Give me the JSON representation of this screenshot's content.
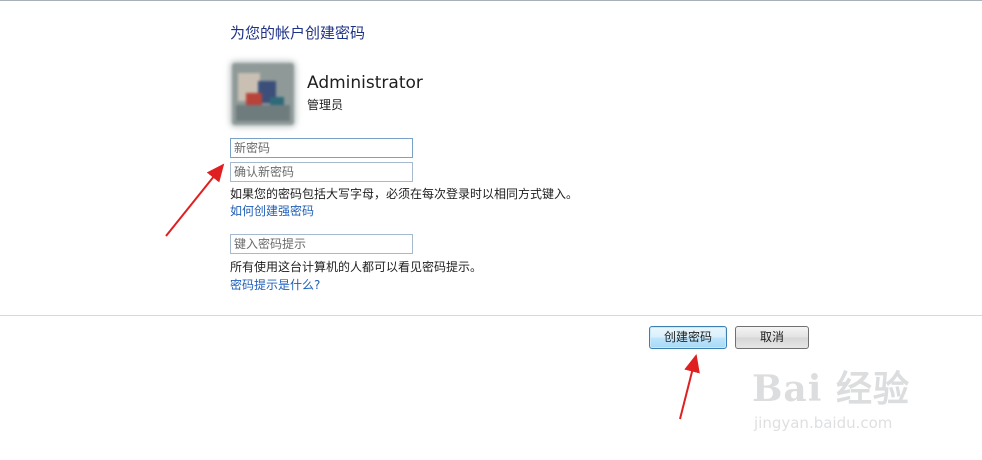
{
  "header": {
    "title": "为您的帐户创建密码"
  },
  "account": {
    "name": "Administrator",
    "role": "管理员"
  },
  "form": {
    "new_password_placeholder": "新密码",
    "confirm_password_placeholder": "确认新密码",
    "case_notice": "如果您的密码包括大写字母，必须在每次登录时以相同方式键入。",
    "strong_password_link": "如何创建强密码",
    "hint_placeholder": "键入密码提示",
    "hint_notice": "所有使用这台计算机的人都可以看见密码提示。",
    "hint_help_link": "密码提示是什么?"
  },
  "buttons": {
    "create": "创建密码",
    "cancel": "取消"
  },
  "watermark": {
    "brand": "Bai 经验",
    "url": "jingyan.baidu.com"
  },
  "colors": {
    "title": "#1e3287",
    "link": "#1f5fb8",
    "annotation_arrow": "#e02020"
  }
}
